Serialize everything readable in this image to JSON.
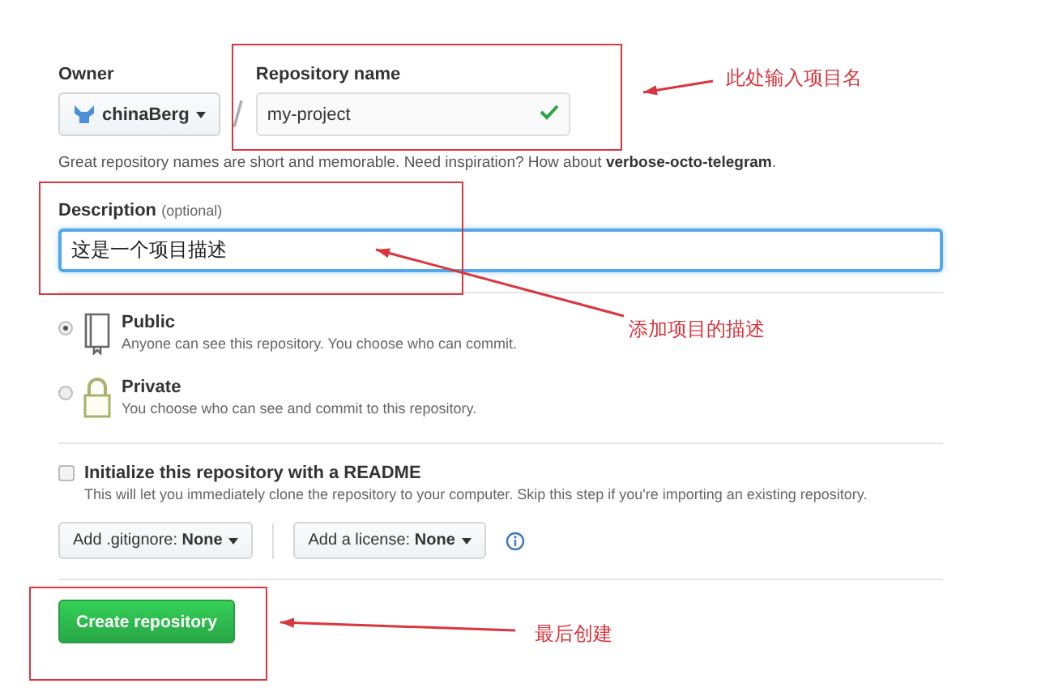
{
  "owner": {
    "label": "Owner",
    "name": "chinaBerg"
  },
  "separator": "/",
  "repository_name": {
    "label": "Repository name",
    "value": "my-project",
    "valid": true
  },
  "hint": "Great repository names are short and memorable. Need inspiration? How about **verbose-octo-telegram**.",
  "description": {
    "label": "Description",
    "note": "(optional)",
    "value": "这是一个项目描述",
    "focused": true
  },
  "visibility": [
    {
      "title": "Public",
      "description": "Anyone can see this repository. You choose who can commit.",
      "selected": true
    },
    {
      "title": "Private",
      "description": "You choose who can see and commit to this repository.",
      "selected": false
    }
  ],
  "readme": {
    "label": "Initialize this repository with a README",
    "description": "This will let you immediately clone the repository to your computer. Skip this step if you're importing an existing repository.",
    "checked": false
  },
  "dropdowns": [
    {
      "prefix": "Add .gitignore:",
      "value": "None"
    },
    {
      "prefix": "Add a license:",
      "value": "None"
    }
  ],
  "create_button": "Create repository",
  "annotations": [
    {
      "text": "此处输入项目名"
    },
    {
      "text": "添加项目的描述"
    },
    {
      "text": "最后创建"
    }
  ]
}
